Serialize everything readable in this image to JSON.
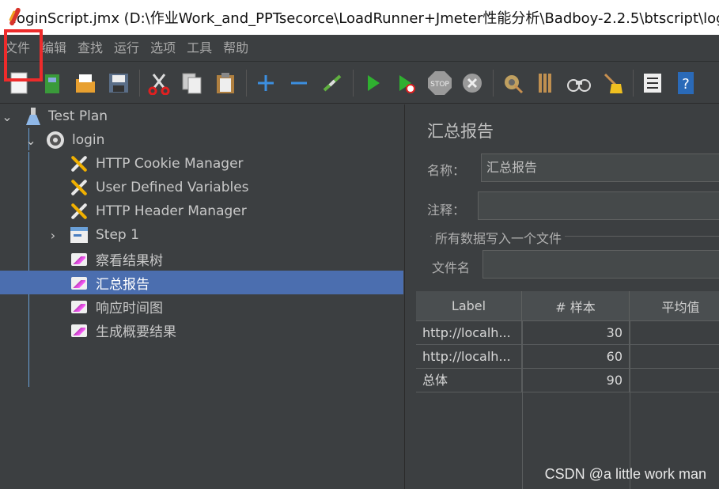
{
  "window": {
    "title": "loginScript.jmx (D:\\作业Work_and_PPTsecorce\\LoadRunner+Jmeter性能分析\\Badboy-2.2.5\\btscript\\log"
  },
  "menu": [
    "文件",
    "编辑",
    "查找",
    "运行",
    "选项",
    "工具",
    "帮助"
  ],
  "toolbar": {
    "icons": [
      "new-icon",
      "templates-icon",
      "open-icon",
      "save-icon",
      "cut-icon",
      "copy-icon",
      "paste-icon",
      "expand-icon",
      "collapse-icon",
      "toggle-icon",
      "start-icon",
      "start-no-pause-icon",
      "stop-icon",
      "shutdown-icon",
      "clear-icon",
      "clear-all-icon",
      "search-icon",
      "reset-search-icon",
      "function-helper-icon",
      "help-icon"
    ]
  },
  "tree": {
    "items": [
      {
        "label": "Test Plan",
        "icon": "flask-icon"
      },
      {
        "label": "login",
        "icon": "gear-icon"
      },
      {
        "label": "HTTP Cookie Manager",
        "icon": "wrench-icon"
      },
      {
        "label": "User Defined Variables",
        "icon": "wrench-icon"
      },
      {
        "label": "HTTP Header Manager",
        "icon": "wrench-icon"
      },
      {
        "label": "Step 1",
        "icon": "controller-icon"
      },
      {
        "label": "察看结果树",
        "icon": "listener-icon"
      },
      {
        "label": "汇总报告",
        "icon": "listener-icon"
      },
      {
        "label": "响应时间图",
        "icon": "listener-icon"
      },
      {
        "label": "生成概要结果",
        "icon": "listener-icon"
      }
    ]
  },
  "panel": {
    "title": "汇总报告",
    "name_label": "名称：",
    "name_value": "汇总报告",
    "comment_label": "注释：",
    "comment_value": "",
    "group_title": "所有数据写入一个文件",
    "filename_label": "文件名",
    "filename_value": ""
  },
  "table": {
    "headers": [
      "Label",
      "# 样本",
      "平均值"
    ],
    "rows": [
      {
        "label": "http://localh...",
        "samples": "30",
        "average": ""
      },
      {
        "label": "http://localh...",
        "samples": "60",
        "average": ""
      },
      {
        "label": "总体",
        "samples": "90",
        "average": ""
      }
    ]
  },
  "watermark": "CSDN @a little work man",
  "colors": {
    "background": "#3c3f41",
    "selection": "#4b6eaf",
    "highlight_box": "#ee2b2b"
  }
}
